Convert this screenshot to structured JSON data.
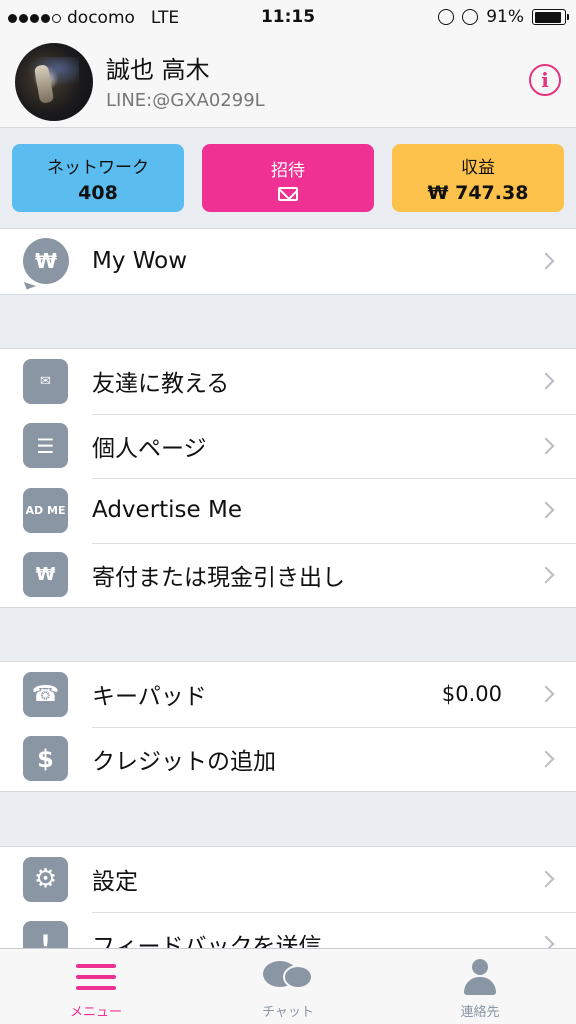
{
  "status_bar": {
    "carrier": "docomo",
    "network": "LTE",
    "time": "11:15",
    "battery": "91%",
    "battery_level": 0.91
  },
  "profile": {
    "name": "誠也 高木",
    "line_id": "LINE:@GXA0299L"
  },
  "stats": {
    "network_label": "ネットワーク",
    "network_value": "408",
    "invite_label": "招待",
    "earnings_label": "収益",
    "earnings_value": "₩ 747.38"
  },
  "menu": {
    "my_wow": "My Wow",
    "tell_friends": "友達に教える",
    "personal_page": "個人ページ",
    "advertise_me": "Advertise Me",
    "advertise_icon_text": "AD ME",
    "donate_withdraw": "寄付または現金引き出し",
    "keypad": "キーパッド",
    "keypad_balance": "$0.00",
    "add_credit": "クレジットの追加",
    "settings": "設定",
    "feedback": "フィードバックを送信"
  },
  "tabs": {
    "menu": "メニュー",
    "chat": "チャット",
    "contacts": "連絡先"
  },
  "colors": {
    "accent_pink": "#ef3193",
    "network_blue": "#5bbcf0",
    "earnings_yellow": "#fdc24b",
    "icon_gray": "#8a96a3"
  }
}
